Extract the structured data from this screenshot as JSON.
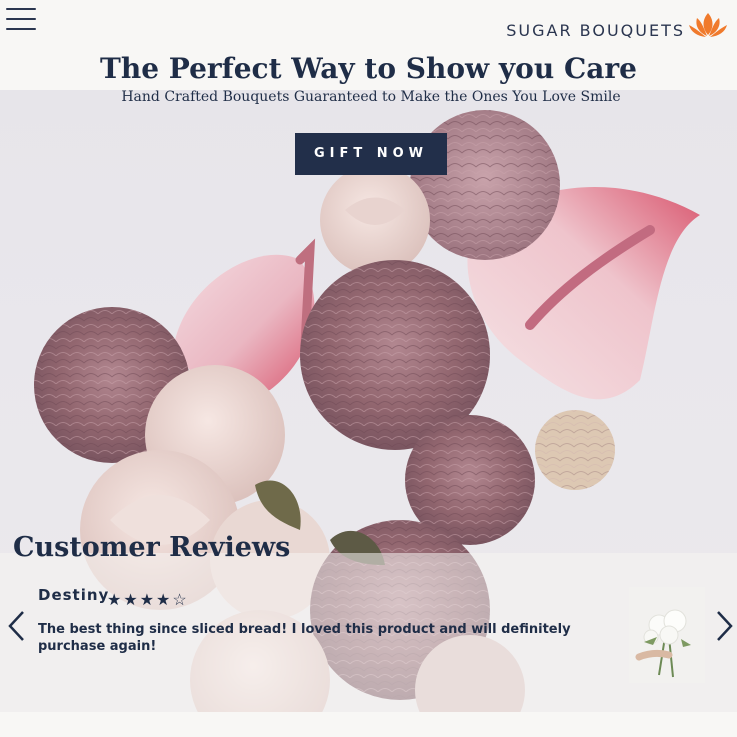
{
  "header": {
    "brand_name": "SUGAR BOUQUETS",
    "menu_icon": "hamburger-menu-icon",
    "logo_icon": "lotus-icon"
  },
  "hero": {
    "title": "The Perfect Way to Show you Care",
    "subtitle": "Hand Crafted Bouquets Guaranteed to Make the Ones You Love Smile",
    "cta_label": "GIFT NOW"
  },
  "reviews": {
    "title": "Customer Reviews",
    "items": [
      {
        "name": "Destiny",
        "stars": "★★★★☆",
        "rating": 4,
        "text": "The best thing since sliced bread! I loved this product and will definitely purchase again!"
      }
    ],
    "prev_icon": "chevron-left-icon",
    "next_icon": "chevron-right-icon"
  },
  "colors": {
    "navy": "#222f4a",
    "accent_orange": "#f07a2c",
    "background": "#f8f7f5"
  }
}
